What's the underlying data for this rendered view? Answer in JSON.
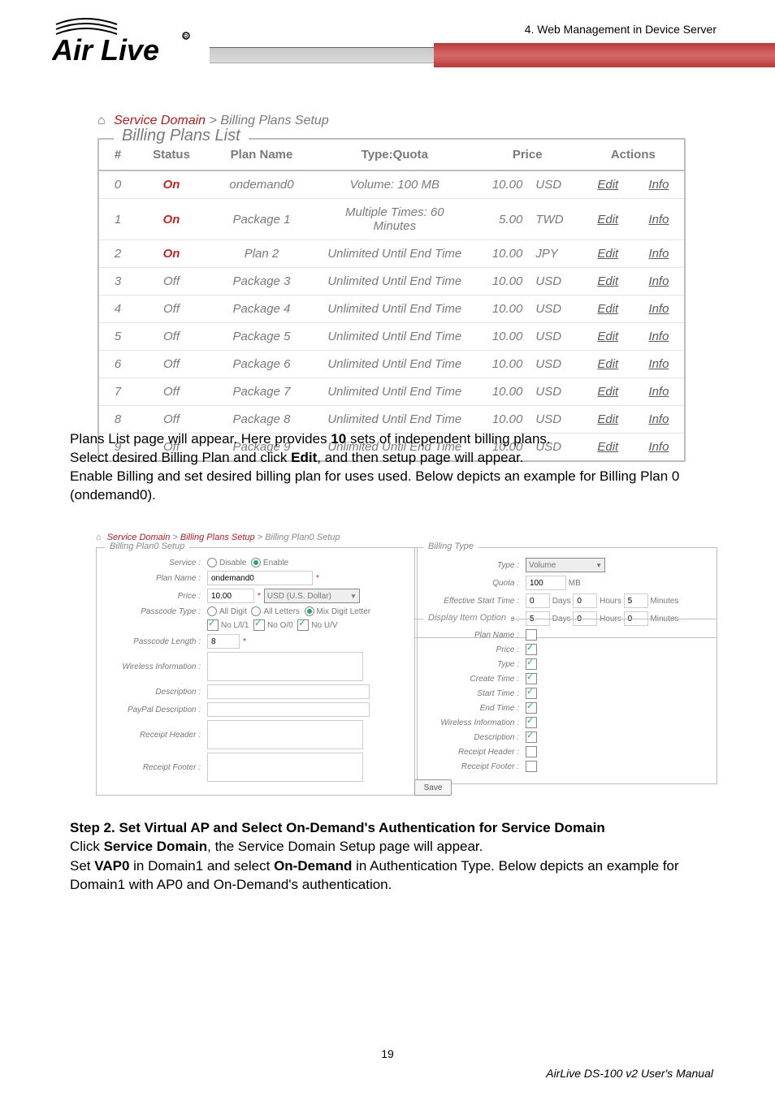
{
  "header": {
    "chapter": "4. Web Management in Device Server",
    "logo_text": "Air Live"
  },
  "breadcrumb1": {
    "home_glyph": "⌂",
    "a": "Service Domain",
    "sep": " > ",
    "b": "Billing Plans Setup"
  },
  "billing_plans_list": {
    "fieldset_title": "Billing Plans List",
    "headers": {
      "n": "#",
      "status": "Status",
      "plan": "Plan Name",
      "type": "Type:Quota",
      "price": "Price",
      "actions": "Actions"
    },
    "action_labels": {
      "edit": "Edit",
      "info": "Info"
    },
    "rows": [
      {
        "n": "0",
        "status": "On",
        "plan": "ondemand0",
        "type": "Volume: 100 MB",
        "price": "10.00",
        "cur": "USD"
      },
      {
        "n": "1",
        "status": "On",
        "plan": "Package 1",
        "type": "Multiple Times: 60 Minutes",
        "price": "5.00",
        "cur": "TWD"
      },
      {
        "n": "2",
        "status": "On",
        "plan": "Plan 2",
        "type": "Unlimited Until End Time",
        "price": "10.00",
        "cur": "JPY"
      },
      {
        "n": "3",
        "status": "Off",
        "plan": "Package 3",
        "type": "Unlimited Until End Time",
        "price": "10.00",
        "cur": "USD"
      },
      {
        "n": "4",
        "status": "Off",
        "plan": "Package 4",
        "type": "Unlimited Until End Time",
        "price": "10.00",
        "cur": "USD"
      },
      {
        "n": "5",
        "status": "Off",
        "plan": "Package 5",
        "type": "Unlimited Until End Time",
        "price": "10.00",
        "cur": "USD"
      },
      {
        "n": "6",
        "status": "Off",
        "plan": "Package 6",
        "type": "Unlimited Until End Time",
        "price": "10.00",
        "cur": "USD"
      },
      {
        "n": "7",
        "status": "Off",
        "plan": "Package 7",
        "type": "Unlimited Until End Time",
        "price": "10.00",
        "cur": "USD"
      },
      {
        "n": "8",
        "status": "Off",
        "plan": "Package 8",
        "type": "Unlimited Until End Time",
        "price": "10.00",
        "cur": "USD"
      },
      {
        "n": "9",
        "status": "Off",
        "plan": "Package 9",
        "type": "Unlimited Until End Time",
        "price": "10.00",
        "cur": "USD"
      }
    ]
  },
  "body1": {
    "l1a": "Plans List page will appear. Here provides ",
    "l1b": "10",
    "l1c": " sets of independent billing plans.",
    "l2a": "Select desired Billing Plan and click ",
    "l2b": "Edit",
    "l2c": ", and then setup page will appear.",
    "l3": "Enable Billing and set desired billing plan for uses used. Below depicts an example for Billing Plan 0 (ondemand0)."
  },
  "breadcrumb2": {
    "home_glyph": "⌂",
    "a": "Service Domain",
    "b": "Billing Plans Setup",
    "c": "Billing Plan0 Setup",
    "sep": " > "
  },
  "plan0_setup": {
    "fieldset_title": "Billing Plan0 Setup",
    "labels": {
      "service": "Service :",
      "disable": "Disable",
      "enable": "Enable",
      "plan_name": "Plan Name :",
      "price": "Price :",
      "passcode_type": "Passcode Type :",
      "all_digit": "All Digit",
      "all_letters": "All Letters",
      "mix_digit_letter": "Mix Digit Letter",
      "no_l": "No L/l/1",
      "no_o": "No O/0",
      "no_u": "No U/V",
      "passcode_len": "Passcode Length :",
      "wireless_info": "Wireless Information :",
      "description": "Description :",
      "paypal_desc": "PayPal Description :",
      "receipt_header": "Receipt Header :",
      "receipt_footer": "Receipt Footer :"
    },
    "values": {
      "plan_name": "ondemand0",
      "price": "10.00",
      "currency": "USD (U.S. Dollar)",
      "passcode_len": "8",
      "service_enabled": true,
      "passcode_sel": "mix",
      "chk_no_l": true,
      "chk_no_o": true,
      "chk_no_u": true
    }
  },
  "billing_type": {
    "fieldset_title": "Billing Type",
    "labels": {
      "type": "Type :",
      "quota": "Quota :",
      "eff_start": "Effective Start Time :",
      "eff_end": "Effective End Time :",
      "units_mb": "MB",
      "days": "Days",
      "hours": "Hours",
      "minutes": "Minutes"
    },
    "values": {
      "type": "Volume",
      "quota": "100",
      "start_days": "0",
      "start_hours": "0",
      "start_mins": "5",
      "end_days": "5",
      "end_hours": "0",
      "end_mins": "0"
    }
  },
  "display_item_option": {
    "fieldset_title": "Display Item Option",
    "items": [
      {
        "label": "Plan Name :",
        "checked": false
      },
      {
        "label": "Price :",
        "checked": true
      },
      {
        "label": "Type :",
        "checked": true
      },
      {
        "label": "Create Time :",
        "checked": true
      },
      {
        "label": "Start Time :",
        "checked": true
      },
      {
        "label": "End Time :",
        "checked": true
      },
      {
        "label": "Wireless Information :",
        "checked": true
      },
      {
        "label": "Description :",
        "checked": true
      },
      {
        "label": "Receipt Header :",
        "checked": false
      },
      {
        "label": "Receipt Footer :",
        "checked": false
      }
    ]
  },
  "save_button": "Save",
  "step2": {
    "h": "Step 2.   Set Virtual AP and Select On-Demand's Authentication for Service Domain",
    "l1a": "Click ",
    "l1b": "Service Domain",
    "l1c": ", the Service Domain Setup page will appear.",
    "l2a": "Set ",
    "l2b": "VAP0",
    "l2c": " in Domain1 and select ",
    "l2d": "On-Demand",
    "l2e": " in Authentication Type. Below depicts an example for Domain1 with AP0 and On-Demand's authentication."
  },
  "footer": {
    "page": "19",
    "right": "AirLive DS-100 v2 User's Manual"
  }
}
